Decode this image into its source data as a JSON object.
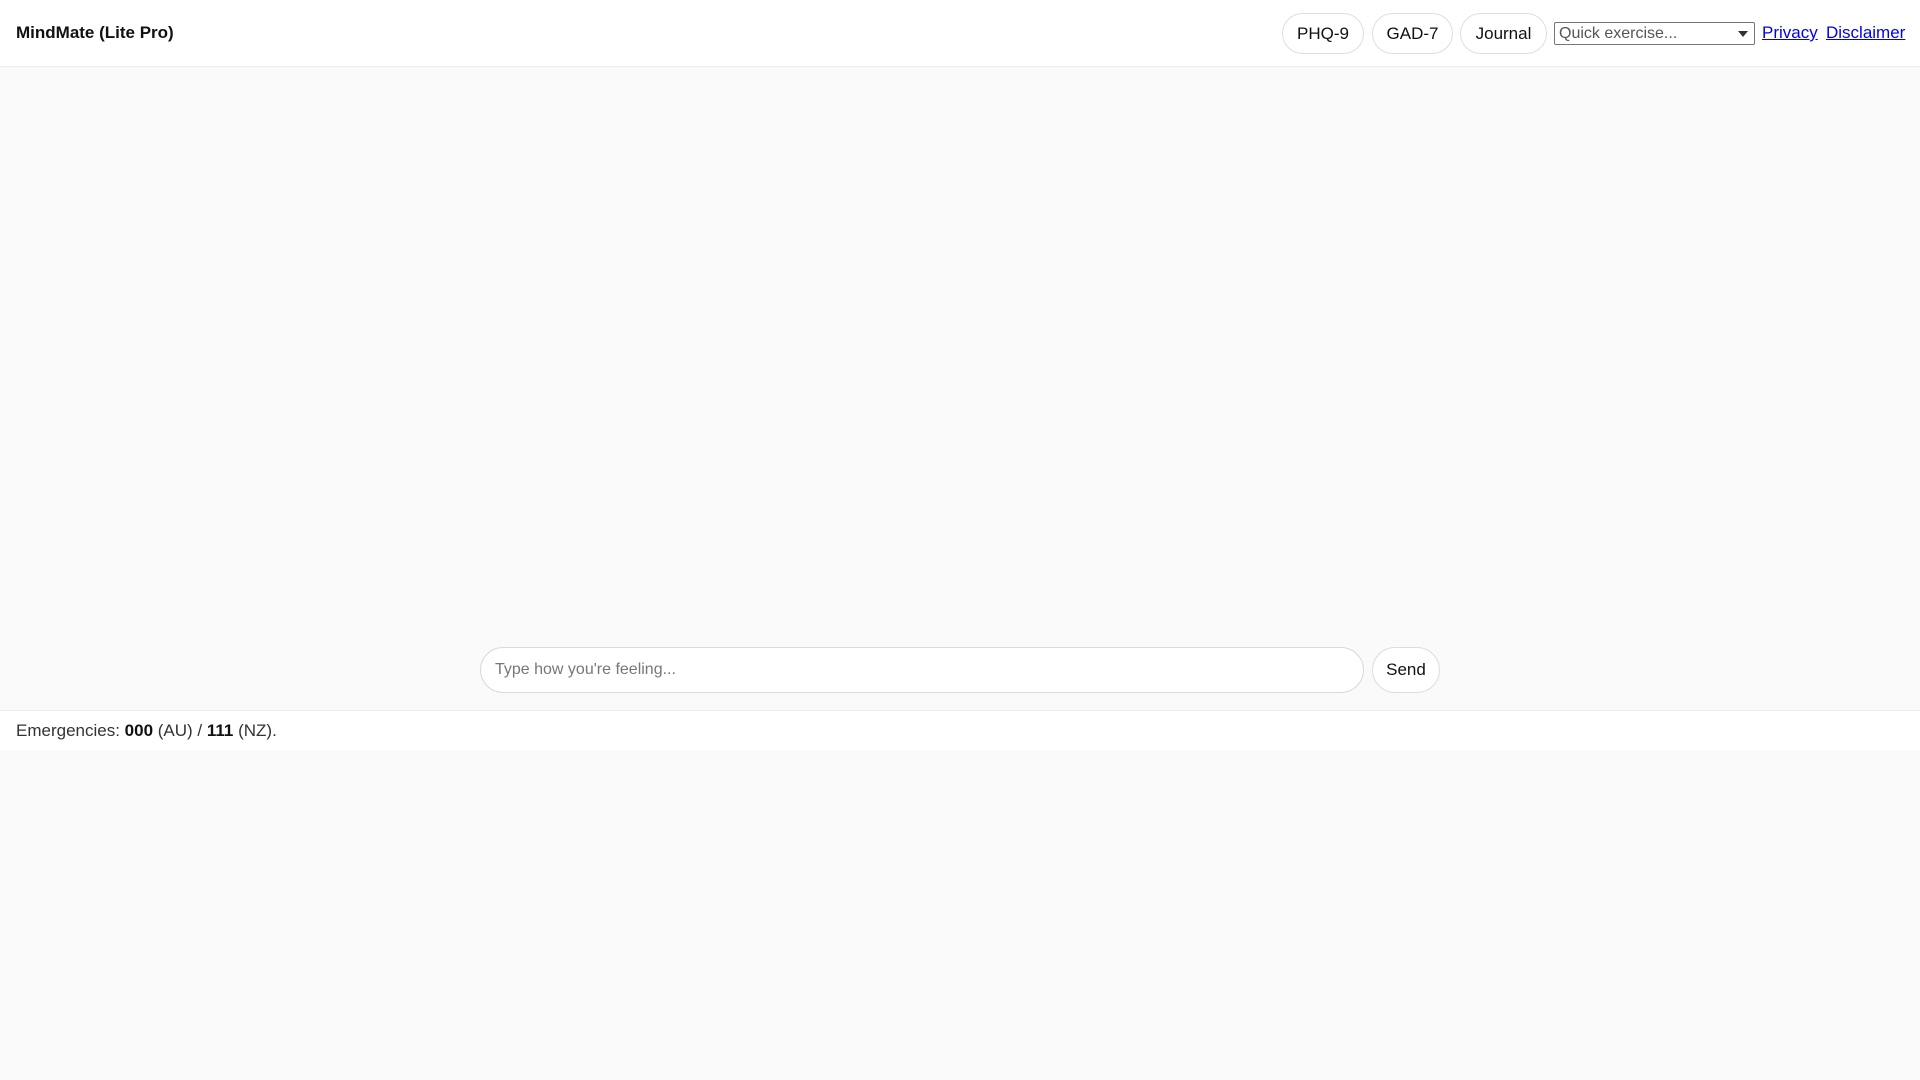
{
  "header": {
    "title": "MindMate (Lite Pro)",
    "buttons": {
      "phq9": "PHQ-9",
      "gad7": "GAD-7",
      "journal": "Journal"
    },
    "exercise_select": {
      "selected": "Quick exercise..."
    },
    "links": {
      "privacy": "Privacy",
      "disclaimer": "Disclaimer"
    }
  },
  "composer": {
    "placeholder": "Type how you're feeling...",
    "send_label": "Send"
  },
  "footer": {
    "prefix": "Emergencies: ",
    "au_number": "000",
    "au_label": " (AU) / ",
    "nz_number": "111",
    "nz_label": " (NZ)."
  }
}
